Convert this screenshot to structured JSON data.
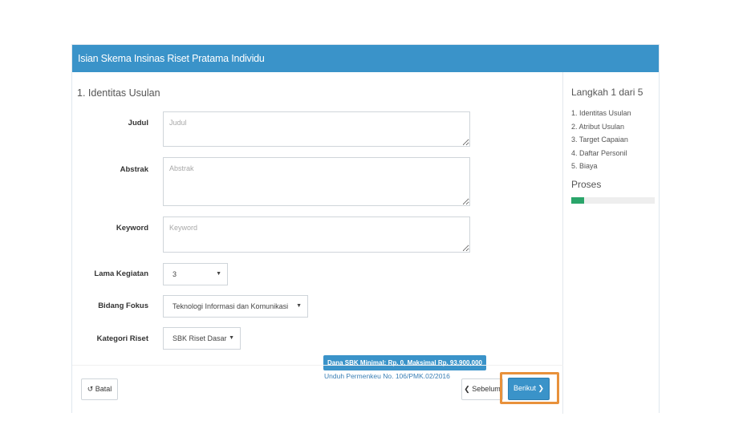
{
  "panel": {
    "title": "Isian Skema Insinas Riset Pratama Individu"
  },
  "form": {
    "section_title": "1. Identitas Usulan",
    "judul": {
      "label": "Judul",
      "placeholder": "Judul"
    },
    "abstrak": {
      "label": "Abstrak",
      "placeholder": "Abstrak"
    },
    "keyword": {
      "label": "Keyword",
      "placeholder": "Keyword"
    },
    "lama_kegiatan": {
      "label": "Lama Kegiatan",
      "value": "3"
    },
    "bidang_fokus": {
      "label": "Bidang Fokus",
      "value": "Teknologi Informasi dan Komunikasi"
    },
    "kategori_riset": {
      "label": "Kategori Riset",
      "value": "SBK Riset Dasar"
    },
    "sbk_info": "Dana SBK Minimal: Rp. 0, Maksimal Rp. 93,900,000",
    "sbk_link": "Unduh Permenkeu No. 106/PMK.02/2016"
  },
  "buttons": {
    "batal": "Batal",
    "sebelum": "Sebelum",
    "berikut": "Berikut"
  },
  "sidebar": {
    "title": "Langkah 1 dari 5",
    "steps": [
      "1. Identitas Usulan",
      "2. Atribut Usulan",
      "3. Target Capaian",
      "4. Daftar Personil",
      "5. Biaya"
    ],
    "proses_title": "Proses",
    "progress_fraction": 0.15
  },
  "colors": {
    "header": "#3a93c9",
    "progress": "#2aa56a",
    "highlight": "#e8913b"
  }
}
